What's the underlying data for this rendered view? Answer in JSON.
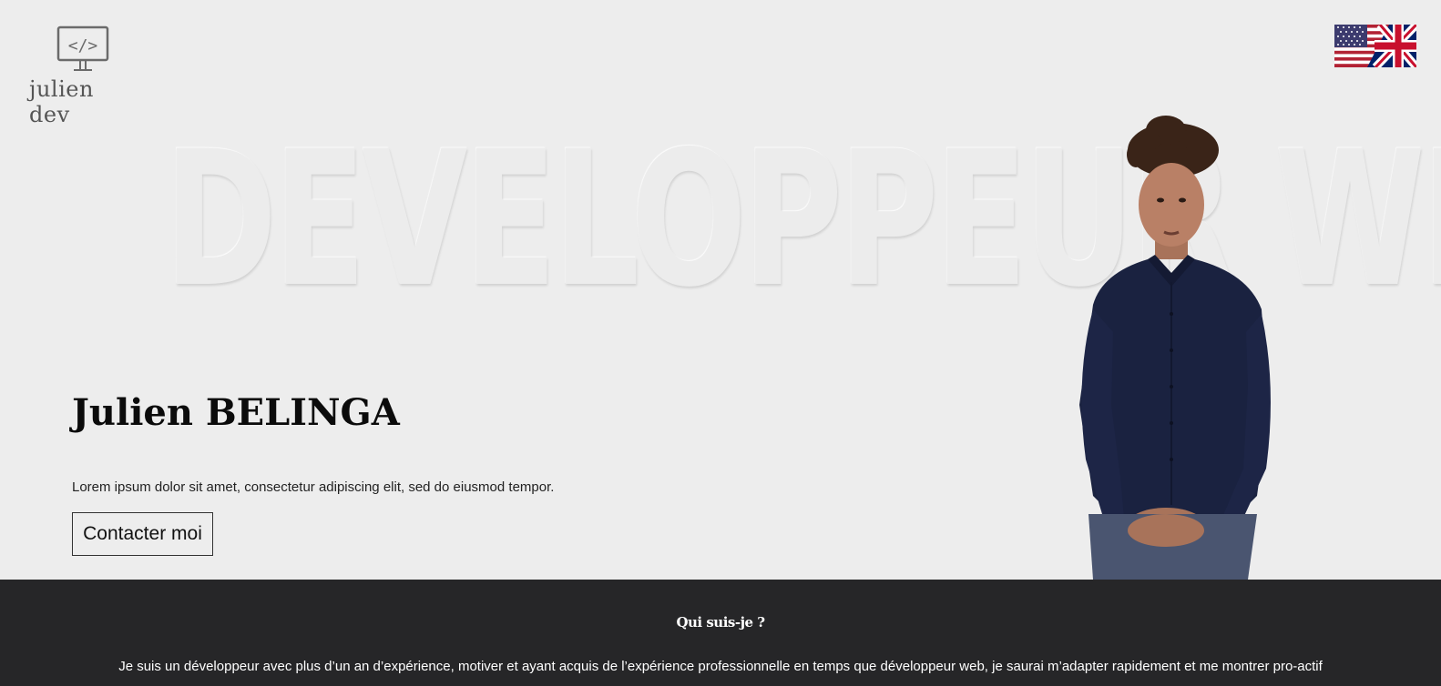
{
  "header": {
    "logo_text": "julien dev",
    "logo_icon": "code-monitor-icon",
    "language_flag": "uk-flag-icon"
  },
  "hero": {
    "background_title": "DEVELOPPEUR WEB",
    "name": "Julien BELINGA",
    "description": "Lorem ipsum dolor sit amet, consectetur adipiscing elit, sed do eiusmod tempor.",
    "contact_button": "Contacter moi"
  },
  "about": {
    "title": "Qui suis-je ?",
    "text": "Je suis un développeur avec plus d’un an d’expérience, motiver et ayant acquis de l’expérience professionnelle en temps que développeur web, je saurai m’adapter rapidement et me montrer pro-actif"
  },
  "colors": {
    "hero_background": "#ededed",
    "about_background": "#262628",
    "text_dark": "#0b0b0b",
    "shirt_navy": "#1a2240"
  }
}
